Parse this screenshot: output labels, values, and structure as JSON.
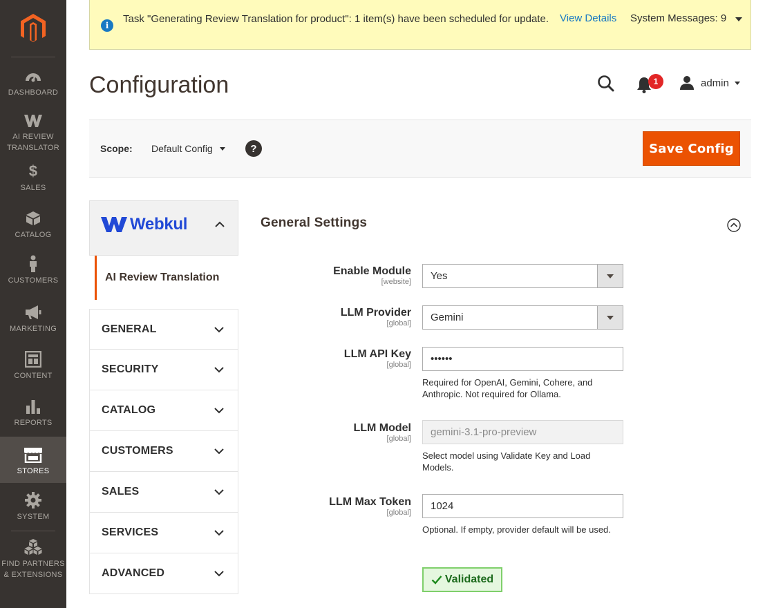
{
  "sidebar": {
    "items": [
      {
        "key": "dashboard",
        "label": "DASHBOARD",
        "icon": "dashboard-icon"
      },
      {
        "key": "ai-review",
        "label": "AI REVIEW\nTRANSLATOR",
        "icon": "webkul-w-icon"
      },
      {
        "key": "sales",
        "label": "SALES",
        "icon": "dollar-icon"
      },
      {
        "key": "catalog",
        "label": "CATALOG",
        "icon": "cube-icon"
      },
      {
        "key": "customers",
        "label": "CUSTOMERS",
        "icon": "person-icon"
      },
      {
        "key": "marketing",
        "label": "MARKETING",
        "icon": "megaphone-icon"
      },
      {
        "key": "content",
        "label": "CONTENT",
        "icon": "layout-icon"
      },
      {
        "key": "reports",
        "label": "REPORTS",
        "icon": "bar-chart-icon"
      },
      {
        "key": "stores",
        "label": "STORES",
        "icon": "storefront-icon",
        "active": true
      },
      {
        "key": "system",
        "label": "SYSTEM",
        "icon": "gear-icon"
      },
      {
        "key": "partners",
        "label": "FIND PARTNERS\n& EXTENSIONS",
        "icon": "boxes-icon"
      }
    ]
  },
  "notice": {
    "text": "Task \"Generating Review Translation for product\": 1 item(s) have been scheduled for update.",
    "link": "View Details",
    "system_messages": "System Messages: 9"
  },
  "header": {
    "title": "Configuration",
    "notification_count": "1",
    "user": "admin"
  },
  "scope": {
    "label": "Scope:",
    "value": "Default Config",
    "help": "?",
    "save_label": "Save Config"
  },
  "tabs": {
    "vendor": "Webkul",
    "active_item": "AI Review Translation",
    "sections": [
      "GENERAL",
      "SECURITY",
      "CATALOG",
      "CUSTOMERS",
      "SALES",
      "SERVICES",
      "ADVANCED"
    ]
  },
  "main": {
    "section_title": "General Settings",
    "fields": {
      "enable": {
        "label": "Enable Module",
        "scope": "[website]",
        "value": "Yes"
      },
      "provider": {
        "label": "LLM Provider",
        "scope": "[global]",
        "value": "Gemini"
      },
      "api_key": {
        "label": "LLM API Key",
        "scope": "[global]",
        "value": "••••••",
        "note": "Required for OpenAI, Gemini, Cohere, and Anthropic. Not required for Ollama."
      },
      "model": {
        "label": "LLM Model",
        "scope": "[global]",
        "value": "gemini-3.1-pro-preview",
        "note": "Select model using Validate Key and Load Models."
      },
      "max_token": {
        "label": "LLM Max Token",
        "scope": "[global]",
        "value": "1024",
        "note": "Optional. If empty, provider default will be used."
      }
    },
    "validated_label": "Validated"
  },
  "colors": {
    "sidebar_bg": "#373330",
    "accent": "#eb5202",
    "link": "#1979c3",
    "notice_bg": "#fffbbb",
    "webkul_blue": "#2149d6",
    "validated_green": "#7fcf6b"
  }
}
